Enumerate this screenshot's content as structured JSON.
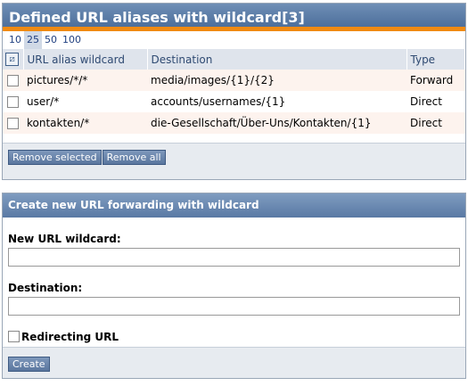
{
  "aliases_panel": {
    "title": "Defined URL aliases with wildcard[3]",
    "pager": [
      "10",
      "25",
      "50",
      "100"
    ],
    "selected_page_size": "25",
    "columns": {
      "alias": "URL alias wildcard",
      "destination": "Destination",
      "type": "Type"
    },
    "rows": [
      {
        "alias": "pictures/*/*",
        "destination": "media/images/{1}/{2}",
        "type": "Forward"
      },
      {
        "alias": "user/*",
        "destination": "accounts/usernames/{1}",
        "type": "Direct"
      },
      {
        "alias": "kontakten/*",
        "destination": "die-Gesellschaft/Über-Uns/Kontakten/{1}",
        "type": "Direct"
      }
    ],
    "remove_selected_label": "Remove selected",
    "remove_all_label": "Remove all"
  },
  "create_panel": {
    "title": "Create new URL forwarding with wildcard",
    "wildcard_label": "New URL wildcard:",
    "wildcard_value": "",
    "destination_label": "Destination:",
    "destination_value": "",
    "redirecting_label": "Redirecting URL",
    "create_label": "Create"
  },
  "colors": {
    "header_blue": "#4d6f9b",
    "accent_orange": "#f08a12"
  },
  "icons": {
    "select_all": "select-all-icon"
  }
}
